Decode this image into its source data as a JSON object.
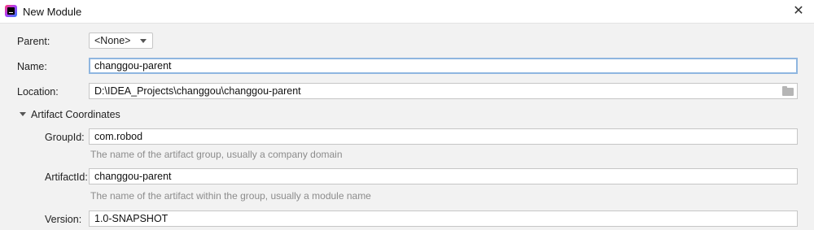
{
  "window": {
    "title": "New Module",
    "close_glyph": "✕",
    "icon": "intellij-idea-icon"
  },
  "form": {
    "parent": {
      "label": "Parent:",
      "value": "<None>"
    },
    "name": {
      "label": "Name:",
      "value": "changgou-parent"
    },
    "location": {
      "label": "Location:",
      "value": "D:\\IDEA_Projects\\changgou\\changgou-parent",
      "browse_icon": "folder-icon"
    }
  },
  "artifact_coordinates": {
    "section_label": "Artifact Coordinates",
    "expanded": true,
    "group_id": {
      "label": "GroupId:",
      "value": "com.robod",
      "hint": "The name of the artifact group, usually a company domain"
    },
    "artifact_id": {
      "label": "ArtifactId:",
      "value": "changgou-parent",
      "hint": "The name of the artifact within the group, usually a module name"
    },
    "version": {
      "label": "Version:",
      "value": "1.0-SNAPSHOT"
    }
  },
  "colors": {
    "focus_border": "#8fb6e0",
    "hint_text": "#8c8c8c",
    "dialog_background": "#f2f2f2"
  }
}
